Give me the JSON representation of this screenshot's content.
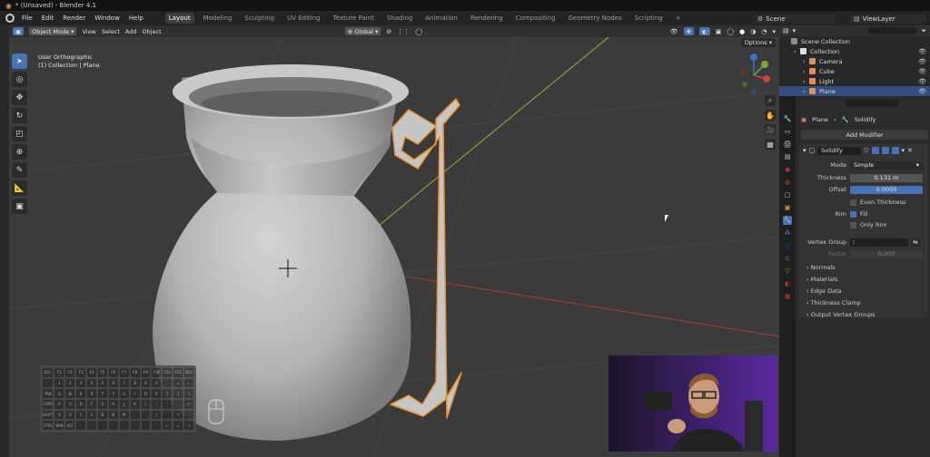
{
  "window": {
    "title": "* (Unsaved) - Blender 4.1"
  },
  "menu": [
    "File",
    "Edit",
    "Render",
    "Window",
    "Help"
  ],
  "workspace_tabs": [
    {
      "label": "Layout",
      "active": true
    },
    {
      "label": "Modeling"
    },
    {
      "label": "Sculpting"
    },
    {
      "label": "UV Editing"
    },
    {
      "label": "Texture Paint"
    },
    {
      "label": "Shading"
    },
    {
      "label": "Animation"
    },
    {
      "label": "Rendering"
    },
    {
      "label": "Compositing"
    },
    {
      "label": "Geometry Nodes"
    },
    {
      "label": "Scripting"
    },
    {
      "label": "+"
    }
  ],
  "scene": {
    "name": "Scene",
    "view_layer": "ViewLayer"
  },
  "viewport_header": {
    "mode": "Object Mode",
    "menus": [
      "View",
      "Select",
      "Add",
      "Object"
    ],
    "transform_orientation": "Global",
    "options_label": "Options"
  },
  "viewport": {
    "view_name": "User Orthographic",
    "collection_info": "(1) Collection | Plane"
  },
  "keyboard_keys": [
    "ESC",
    "F1",
    "F2",
    "F3",
    "F4",
    "F5",
    "F6",
    "F7",
    "F8",
    "F9",
    "F10",
    "F11",
    "F12",
    "DEL",
    "`",
    "1",
    "2",
    "3",
    "4",
    "5",
    "6",
    "7",
    "8",
    "9",
    "0",
    "-",
    "=",
    "←",
    "TAB",
    "Q",
    "W",
    "E",
    "R",
    "T",
    "Y",
    "U",
    "I",
    "O",
    "P",
    "[",
    "]",
    "\\",
    "CAPS",
    "A",
    "S",
    "D",
    "F",
    "G",
    "H",
    "J",
    "K",
    "L",
    ";",
    "'",
    "",
    "↵",
    "SHIFT",
    "Z",
    "X",
    "C",
    "V",
    "B",
    "N",
    "M",
    ",",
    ".",
    "/",
    "",
    "↑",
    "",
    "CTRL",
    "WIN",
    "ALT",
    "",
    "",
    "",
    "",
    "",
    "",
    "",
    "",
    "←",
    "↓",
    "→"
  ],
  "outliner": {
    "search_placeholder": "",
    "items": [
      {
        "label": "Scene Collection",
        "indent": 0,
        "color": "#8c8c8c"
      },
      {
        "label": "Collection",
        "indent": 1,
        "color": "#e0e0e0"
      },
      {
        "label": "Camera",
        "indent": 2,
        "color": "#e38e57"
      },
      {
        "label": "Cube",
        "indent": 2,
        "color": "#e38e57"
      },
      {
        "label": "Light",
        "indent": 2,
        "color": "#e38e57"
      },
      {
        "label": "Plane",
        "indent": 2,
        "color": "#e38e57",
        "selected": true
      }
    ]
  },
  "properties": {
    "search_placeholder": "",
    "breadcrumb_object": "Plane",
    "breadcrumb_modifier": "Solidify",
    "add_modifier_label": "Add Modifier",
    "modifier": {
      "name": "Solidify",
      "mode_label": "Mode",
      "mode_value": "Simple",
      "thickness_label": "Thickness",
      "thickness_value": "0.131 m",
      "offset_label": "Offset",
      "offset_value": "0.0000",
      "even_thickness_label": "Even Thickness",
      "rim_label": "Rim",
      "fill_label": "Fill",
      "only_rim_label": "Only Rim",
      "vertex_group_label": "Vertex Group",
      "factor_label": "Factor",
      "factor_value": "0.000",
      "subpanels": [
        "Normals",
        "Materials",
        "Edge Data",
        "Thickness Clamp",
        "Output Vertex Groups"
      ]
    }
  },
  "colors": {
    "accent": "#4772b3",
    "selection_outline": "#e8922f",
    "x_axis": "#c0392b",
    "y_axis": "#8cbf3f"
  }
}
